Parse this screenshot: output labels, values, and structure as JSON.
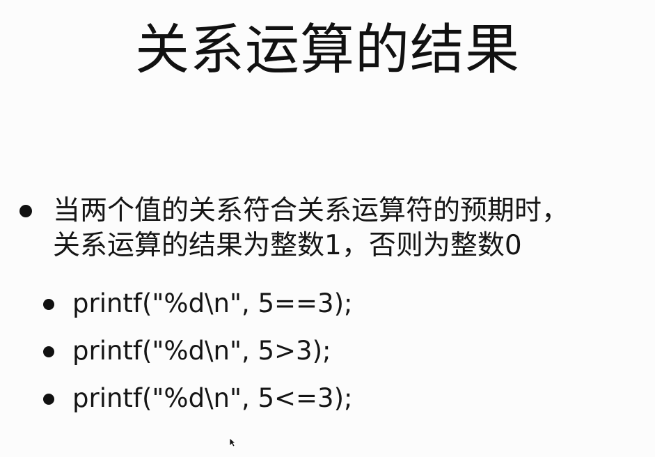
{
  "slide": {
    "title": "关系运算的结果",
    "bullet": {
      "line1": "当两个值的关系符合关系运算符的预期时，",
      "line2": "关系运算的结果为整数1，否则为整数0"
    },
    "code_examples": [
      "printf(\"%d\\n\", 5==3);",
      "printf(\"%d\\n\", 5>3);",
      "printf(\"%d\\n\", 5<=3);"
    ]
  },
  "colors": {
    "background": "#fcfcfc",
    "text": "#111111"
  },
  "icons": {
    "pointer": "mouse-pointer-icon"
  }
}
